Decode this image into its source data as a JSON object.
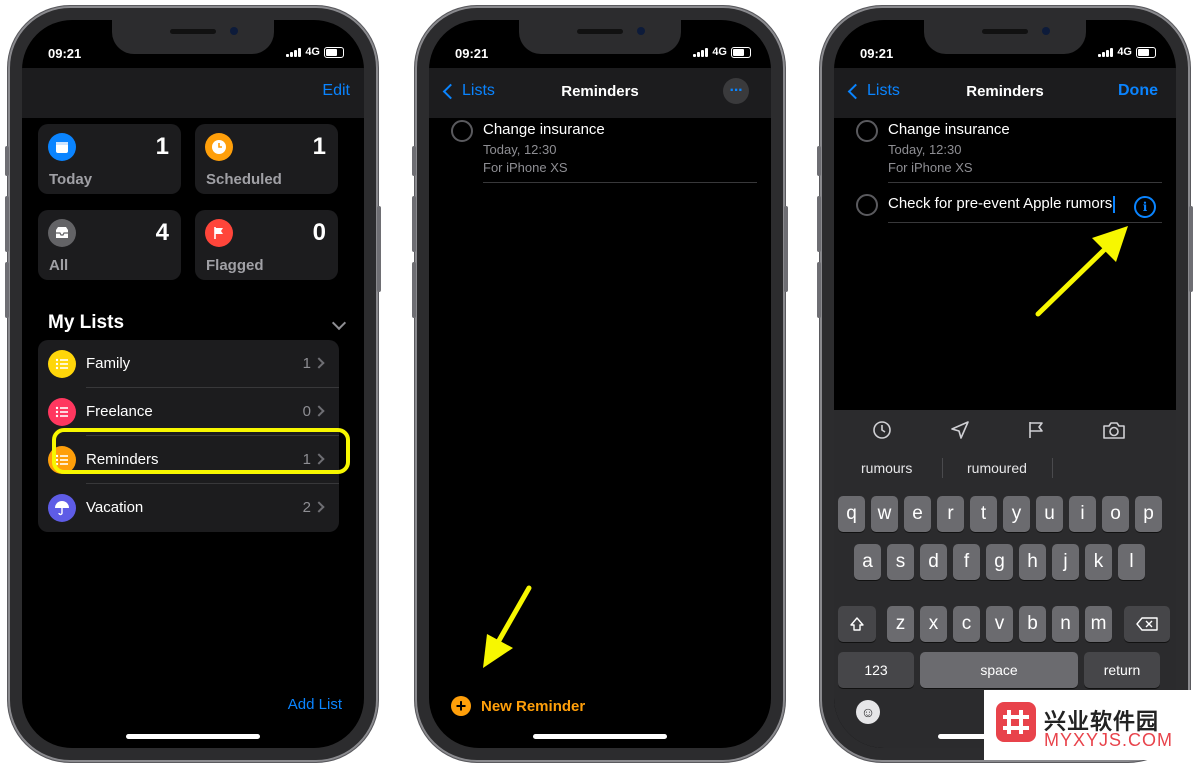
{
  "status": {
    "time": "09:21",
    "network": "4G"
  },
  "screen1": {
    "edit": "Edit",
    "tiles": [
      {
        "label": "Today",
        "count": "1",
        "color": "#0a84ff",
        "icon": "calendar-icon"
      },
      {
        "label": "Scheduled",
        "count": "1",
        "color": "#ff9f0a",
        "icon": "clock-icon"
      },
      {
        "label": "All",
        "count": "4",
        "color": "#636366",
        "icon": "tray-icon"
      },
      {
        "label": "Flagged",
        "count": "0",
        "color": "#ff453a",
        "icon": "flag-icon"
      }
    ],
    "my_lists_title": "My Lists",
    "lists": [
      {
        "name": "Family",
        "count": "1",
        "color": "#ffd60a"
      },
      {
        "name": "Freelance",
        "count": "0",
        "color": "#ff375f"
      },
      {
        "name": "Reminders",
        "count": "1",
        "color": "#ff9f0a"
      },
      {
        "name": "Vacation",
        "count": "2",
        "color": "#5e5ce6"
      }
    ],
    "add_list": "Add List"
  },
  "screen2": {
    "back": "Lists",
    "title": "Reminders",
    "reminder": {
      "title": "Change insurance",
      "date": "Today, 12:30",
      "note": "For iPhone XS"
    },
    "new_reminder": "New Reminder"
  },
  "screen3": {
    "back": "Lists",
    "title": "Reminders",
    "done": "Done",
    "reminder": {
      "title": "Change insurance",
      "date": "Today, 12:30",
      "note": "For iPhone XS"
    },
    "new_item": "Check for pre-event Apple rumors",
    "info": "i",
    "suggestions": [
      "rumours",
      "rumoured"
    ],
    "keyboard": {
      "row1": [
        "q",
        "w",
        "e",
        "r",
        "t",
        "y",
        "u",
        "i",
        "o",
        "p"
      ],
      "row2": [
        "a",
        "s",
        "d",
        "f",
        "g",
        "h",
        "j",
        "k",
        "l"
      ],
      "row3": [
        "z",
        "x",
        "c",
        "v",
        "b",
        "n",
        "m"
      ],
      "numbers": "123",
      "space": "space",
      "return": "return"
    }
  },
  "watermark": {
    "cn": "兴业软件园",
    "url": "MYXYJS.COM"
  }
}
